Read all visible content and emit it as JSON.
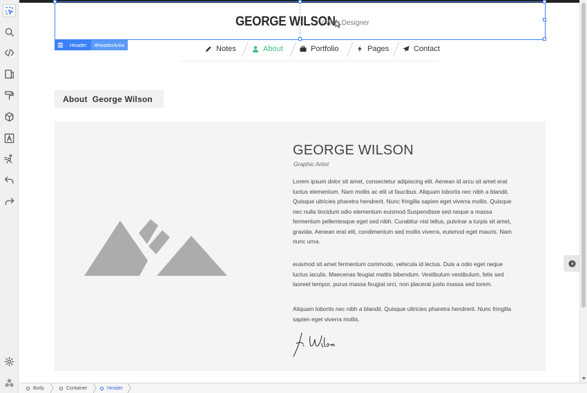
{
  "toolbar": {
    "items": [
      "select-icon",
      "search-icon",
      "code-icon",
      "pages-icon",
      "paint-roller-icon",
      "cube-icon",
      "text-icon",
      "animation-icon",
      "undo-icon",
      "redo-icon"
    ],
    "bottom": [
      "settings-icon",
      "components-icon"
    ]
  },
  "header": {
    "site_name": "GEORGE WILSON",
    "site_role": "/ Web Designer",
    "selection_label": {
      "name": "Header",
      "id": "#headerArea"
    }
  },
  "nav": {
    "items": [
      {
        "label": "Notes",
        "icon": "pencil-icon"
      },
      {
        "label": "About",
        "icon": "user-icon"
      },
      {
        "label": "Portfolio",
        "icon": "briefcase-icon"
      },
      {
        "label": "Pages",
        "icon": "bolt-icon"
      },
      {
        "label": "Contact",
        "icon": "send-icon"
      }
    ],
    "active": "About"
  },
  "about": {
    "heading": "About  George Wilson",
    "name": "GEORGE WILSON",
    "role": "Graphic Artist",
    "bio_1": "Lorem ipsum dolor sit amet, consectetur adipiscing elit. Aenean id arcu sit amet erat luctus elementum. Nam mollis ac elit ut faucibus. Aliquam lobortis nec nibh a blandit. Quisque ultricies pharetra hendrerit. Nunc fringilla sapien eget viverra mollis. Quisque nec nulla tincidunt odio elementum euismod.Suspendisse sed neque a massa fermentum pellentesque eget sed nibh. Curabitur nisl tellus, pulvinar a turpis sit amet, gravida. Aenean erat elit, condimentum sed mollis viverra, euismod eget mauris. Nam nunc urna.",
    "bio_2": "euismod sit amet fermentum commodo, vehicula id lectus. Duis a odio eget neque luctus iaculis. Maecenas feugiat mattis bibendum. Vestibulum vestibulum, felis sed laoreet tempor, purus massa feugiat orci, non placerat justo massa sed lorem.",
    "bio_3": "Aliquam lobortis nec nibh a blandit. Quisque ultricies pharetra hendrerit. Nunc fringilla sapien eget viverra mollis."
  },
  "breadcrumb": [
    "Body",
    "Container",
    "Header"
  ],
  "colors": {
    "accent": "#3b82f6",
    "active_nav": "#3fbf7f",
    "panel": "#f4f4f4"
  }
}
